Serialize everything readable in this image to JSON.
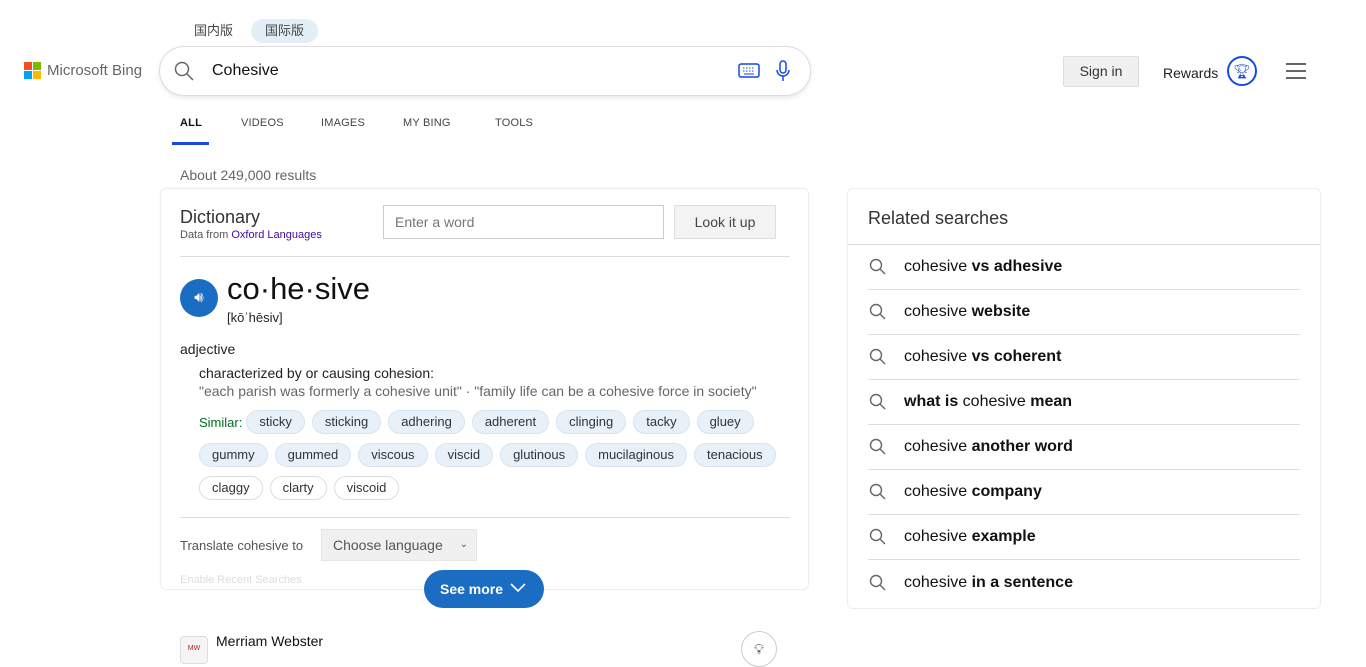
{
  "region_tabs": [
    {
      "label": "国内版",
      "active": false
    },
    {
      "label": "国际版",
      "active": true
    }
  ],
  "logo": {
    "text": "Microsoft Bing",
    "colors": [
      "#f25022",
      "#7fba00",
      "#00a4ef",
      "#ffb900"
    ]
  },
  "search": {
    "value": "Cohesive",
    "icons": [
      "search-icon",
      "keyboard-icon",
      "microphone-icon"
    ]
  },
  "nav": [
    {
      "label": "ALL",
      "active": true
    },
    {
      "label": "VIDEOS"
    },
    {
      "label": "IMAGES"
    },
    {
      "label": "MY BING"
    },
    {
      "label": "TOOLS"
    }
  ],
  "header": {
    "sign_in": "Sign in",
    "rewards": "Rewards"
  },
  "results_count": "About 249,000 results",
  "dictionary": {
    "title": "Dictionary",
    "source_prefix": "Data from ",
    "source_link": "Oxford Languages",
    "input_placeholder": "Enter a word",
    "lookup": "Look it up",
    "headword": "co·he·sive",
    "pronunciation": "[kōˈhēsiv]",
    "pos": "adjective",
    "definition": "characterized by or causing cohesion:",
    "examples": "\"each parish was formerly a cohesive unit\" · \"family life can be a cohesive force in society\"",
    "similar_label": "Similar:",
    "similar": [
      "sticky",
      "sticking",
      "adhering",
      "adherent",
      "clinging",
      "tacky",
      "gluey",
      "gummy",
      "gummed",
      "viscous",
      "viscid",
      "glutinous",
      "mucilaginous",
      "tenacious"
    ],
    "similar_plain": [
      "claggy",
      "clarty",
      "viscoid"
    ],
    "translate_label": "Translate cohesive to",
    "language": "Choose language",
    "faded_text": "Enable Recent Searches",
    "see_more": "See more"
  },
  "next_result": {
    "title": "Merriam Webster",
    "icon_text": "MW"
  },
  "related": {
    "title": "Related searches",
    "items": [
      [
        {
          "t": "cohesive ",
          "b": false
        },
        {
          "t": "vs adhesive",
          "b": true
        }
      ],
      [
        {
          "t": "cohesive ",
          "b": false
        },
        {
          "t": "website",
          "b": true
        }
      ],
      [
        {
          "t": "cohesive ",
          "b": false
        },
        {
          "t": "vs coherent",
          "b": true
        }
      ],
      [
        {
          "t": "what is",
          "b": true
        },
        {
          "t": " cohesive ",
          "b": false
        },
        {
          "t": "mean",
          "b": true
        }
      ],
      [
        {
          "t": "cohesive ",
          "b": false
        },
        {
          "t": "another word",
          "b": true
        }
      ],
      [
        {
          "t": "cohesive ",
          "b": false
        },
        {
          "t": "company",
          "b": true
        }
      ],
      [
        {
          "t": "cohesive ",
          "b": false
        },
        {
          "t": "example",
          "b": true
        }
      ],
      [
        {
          "t": "cohesive ",
          "b": false
        },
        {
          "t": "in a sentence",
          "b": true
        }
      ]
    ]
  }
}
